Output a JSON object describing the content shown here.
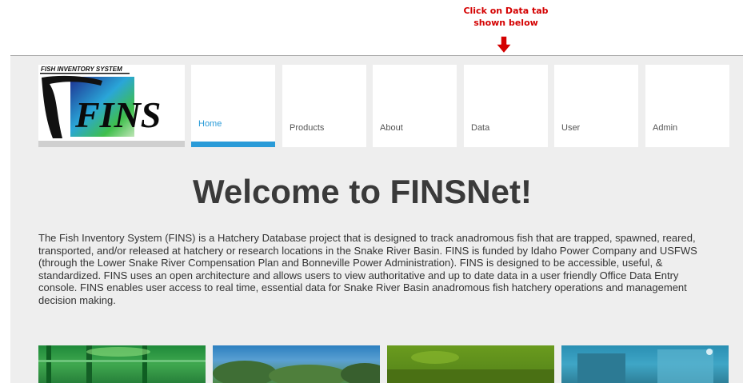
{
  "annotation": {
    "line1": "Click on Data tab",
    "line2": "shown below",
    "arrow_color": "#d40000"
  },
  "logo": {
    "caption": "FISH INVENTORY SYSTEM",
    "letters": "FINS"
  },
  "nav": {
    "active_color": "#2a9bd8",
    "tabs": [
      {
        "label": "Home"
      },
      {
        "label": "Products"
      },
      {
        "label": "About"
      },
      {
        "label": "Data"
      },
      {
        "label": "User"
      },
      {
        "label": "Admin"
      }
    ]
  },
  "main": {
    "title": "Welcome to FINSNet!",
    "intro_lines": [
      "The Fish Inventory System (FINS) is a Hatchery Database project that is designed to track anadromous fish that are trapped, spawned, reared,",
      "transported, and/or released at hatchery or research locations in the Snake River Basin. FINS is funded by Idaho Power Company and USFWS",
      "(through the Lower Snake River Compensation Plan and Bonneville Power Administration). FINS is designed to be accessible, useful, &",
      "standardized. FINS uses an open architecture and allows users to view authoritative and up to date data in a user friendly Office Data Entry",
      "console. FINS enables user access to real time, essential data for Snake River Basin anadromous fish hatchery operations and management",
      "decision making."
    ]
  }
}
